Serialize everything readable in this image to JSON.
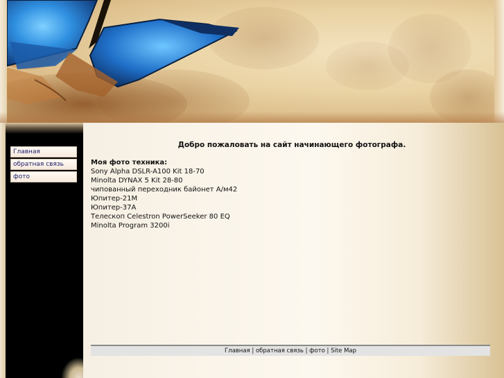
{
  "header": {
    "image": "butterfly-banner",
    "colors": {
      "wing": "#2f8fe0",
      "wing_dark": "#123a7a",
      "parchment": "#ead3a4"
    }
  },
  "sidebar": {
    "items": [
      {
        "label": "Главная"
      },
      {
        "label": "обратная связь"
      },
      {
        "label": "фото"
      }
    ]
  },
  "main": {
    "welcome": "Добро пожаловать на сайт начинающего фотографа.",
    "equipment_title": "Моя фото техника:",
    "equipment": [
      "Sony Alpha DSLR-A100 Kit 18-70",
      "Minolta DYNAX 5 Kit 28-80",
      "чипованный переходник байонет А/м42",
      "Юпитер-21М",
      "Юпитер-37А",
      "Телескоп Celestron PowerSeeker 80 EQ",
      "Minolta Program 3200i"
    ]
  },
  "footer": {
    "links": [
      "Главная",
      "обратная связь",
      "фото",
      "Site Map"
    ],
    "separator": " | "
  }
}
